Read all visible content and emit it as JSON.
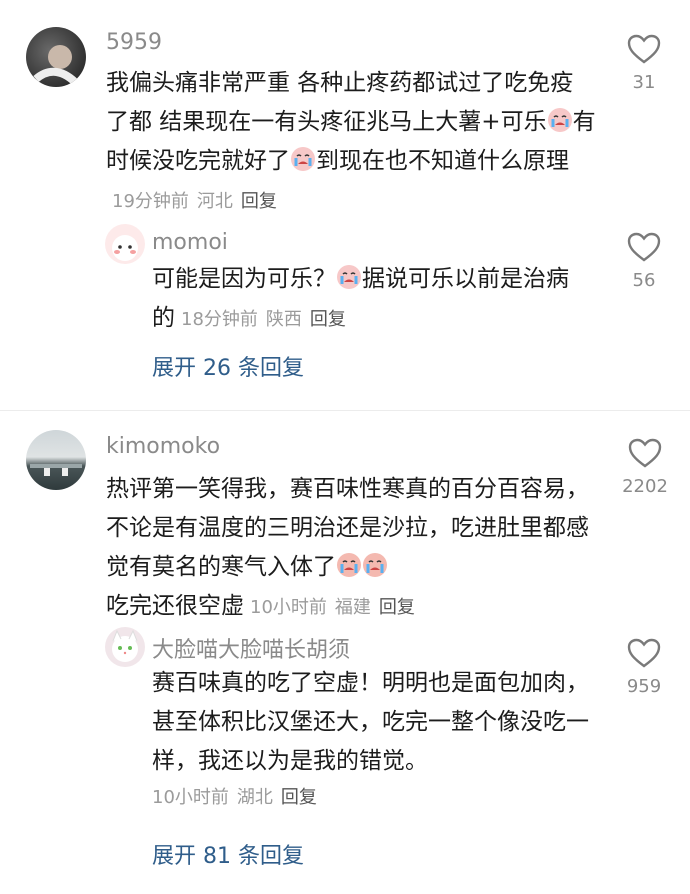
{
  "comments": [
    {
      "user": "5959",
      "text": "我偏头痛非常严重 各种止疼药都试过了吃免疫了都 结果现在一有头疼征兆马上大薯+可乐",
      "emoji_after_1": "crying-face",
      "text_2": "有时候没吃完就好了",
      "emoji_after_2": "crying-face",
      "text_3": "到现在也不知道什么原理",
      "time": "19分钟前",
      "location": "河北",
      "reply_label": "回复",
      "likes": "31",
      "replies": [
        {
          "user": "momoi",
          "text": "可能是因为可乐？",
          "emoji": "crying-face",
          "text_2": "据说可乐以前是治病的",
          "time": "18分钟前",
          "location": "陕西",
          "reply_label": "回复",
          "likes": "56"
        }
      ],
      "expand_label": "展开 26 条回复"
    },
    {
      "user": "kimomoko",
      "text": "热评第一笑得我，赛百味性寒真的百分百容易，不论是有温度的三明治还是沙拉，吃进肚里都感觉有莫名的寒气入体了",
      "emoji": "crying-face",
      "text_2": "吃完还很空虚",
      "time": "10小时前",
      "location": "福建",
      "reply_label": "回复",
      "likes": "2202",
      "replies": [
        {
          "user": "大脸喵大脸喵长胡须",
          "text": "赛百味真的吃了空虚！明明也是面包加肉，甚至体积比汉堡还大，吃完一整个像没吃一样，我还以为是我的错觉。",
          "time": "10小时前",
          "location": "湖北",
          "reply_label": "回复",
          "likes": "959"
        }
      ],
      "expand_label": "展开 81 条回复"
    }
  ],
  "colors": {
    "expand": "#2f5d8a",
    "meta": "#9b9b9b",
    "username": "#8a8a8a"
  },
  "icons": {
    "like": "heart-outline-icon"
  }
}
